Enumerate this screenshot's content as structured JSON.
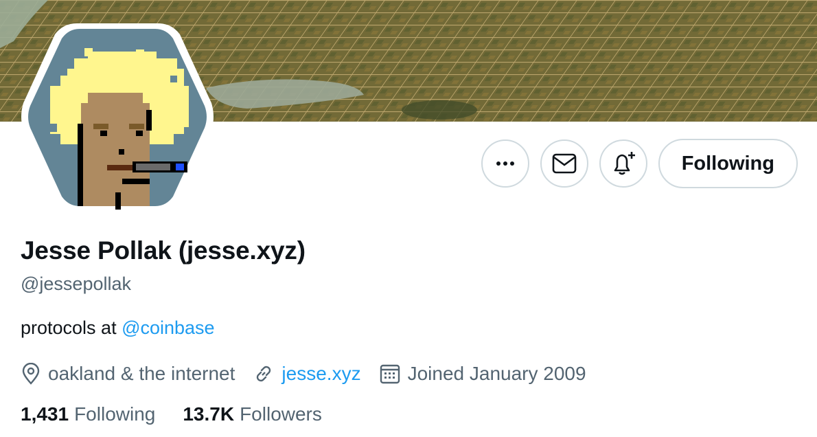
{
  "profile": {
    "name": "Jesse Pollak (jesse.xyz)",
    "handle": "@jessepollak",
    "bio_text": "protocols at ",
    "bio_mention": "@coinbase",
    "location": "oakland & the internet",
    "website": "jesse.xyz",
    "joined": "Joined January 2009"
  },
  "actions": {
    "follow_label": "Following"
  },
  "stats": {
    "following_count": "1,431",
    "following_label": "Following",
    "followers_count": "13.7K",
    "followers_label": "Followers"
  },
  "icons": {
    "more": "more-icon",
    "message": "mail-icon",
    "notify": "bell-plus-icon",
    "location": "location-pin-icon",
    "link": "link-icon",
    "calendar": "calendar-icon"
  },
  "colors": {
    "accent": "#1d9bf0",
    "secondary_text": "#536471",
    "border": "#cfd9de",
    "avatar_bg": "#638596",
    "hair": "#fff68e",
    "skin": "#ae8b61"
  }
}
